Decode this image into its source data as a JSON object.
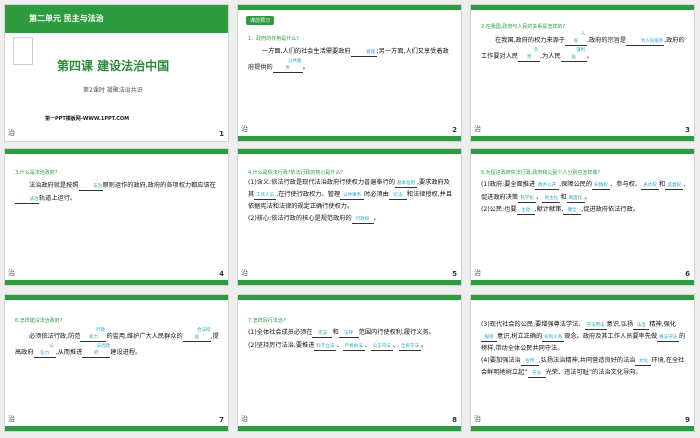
{
  "colors": {
    "green": "#2e9b3e",
    "blank": "#29a3c6"
  },
  "s1": {
    "unit": "第二单元 民主与法治",
    "lesson": "第四课 建设法治中国",
    "sub": "第2课时  凝聚法治共识",
    "footer": "第一PPT模板网-WWW.1PPT.COM",
    "num": "1"
  },
  "s2": {
    "tag": "课前预习",
    "q": "1．政府的作用是什么？",
    "t1": "一方面,人们的社会生活需要政府",
    "b1": "管理",
    "t2": ";另一方面,人们又享受着政府提供的",
    "b2": "公共服务",
    "t3": "。",
    "num": "2"
  },
  "s3": {
    "q": "2.在我国,政府与人民的关系是怎样的?",
    "t1": "在我国,政府的权力来源于",
    "b1": "人民",
    "t2": ",政府的宗旨是",
    "b2": "为人民服务",
    "t3": ",政府的工作要对人民",
    "b3": "负责",
    "t4": ",为人民",
    "b4": "谋利益",
    "t5": "。",
    "num": "3"
  },
  "s4": {
    "q": "3.什么是法治政府?",
    "t1": "法治政府就是按照",
    "b1": "法治",
    "t2": "原则运作的政府,政府的各项权力都应该在",
    "b2": "法治",
    "t3": "轨道上运行。",
    "num": "4"
  },
  "s5": {
    "q": "4.什么是依法行政?依法行政的核心是什么?",
    "t1": "(1)含义:依法行政是现代法治政府行使权力普遍奉行的",
    "b1": "基本准则",
    "t2": ",要求政府及其",
    "b2": "工作人员",
    "t3": ",在行使行政权力、管理",
    "b3": "公共事务",
    "t4": "时必须由",
    "b4": "宪法",
    "t5": "和法律授权,并且依据宪法和法律的规定正确行使权力。",
    "t6": "(2)核心:依法行政的核心是规范政府的",
    "b5": "行政权",
    "t7": "。",
    "num": "5"
  },
  "s6": {
    "q": "5.为促进政府依法行政,政府和公民个人分别应怎样做?",
    "t1": "(1)政府:要全面推进",
    "b1": "政务公开",
    "t2": ",保障公民的",
    "b2": "知情权",
    "t3": "、参与权、",
    "b3": "表达权",
    "t4": "和",
    "b4": "监督权",
    "t5": ",促进政府决策",
    "b5": "科学化",
    "t6": "、",
    "b6": "民主化",
    "t7": "和",
    "b7": "制度化",
    "t8": "。",
    "b8": "主动",
    "b9": "健全",
    "t9": "(2)公民:也要",
    "t10": ",献计献策,",
    "t11": ",促进政府依法行政。",
    "num": "6"
  },
  "s7": {
    "q": "6.怎样建设法治政府?",
    "t1": "必须依法行政,防范",
    "b1": "行政权力",
    "t2": "的滥用,维护广大人民群众的",
    "b2": "合法权益",
    "t3": ",提高政府",
    "b3": "公信力",
    "t4": ",从而推进",
    "b4": "法治政府",
    "t5": "建设进程。",
    "num": "7"
  },
  "s8": {
    "q": "7.怎样厉行法治?",
    "t1": "(1)全体社会成员必须在",
    "b1": "宪法",
    "t2": "和",
    "b2": "法律",
    "t3": "范围内行使权利,履行义务。",
    "t4": "(2)坚持厉行法治,要推进",
    "b3": "科学立法",
    "t5": "、",
    "b4": "严格执法",
    "t6": "、",
    "b5": "公正司法",
    "t7": "、",
    "b6": "全民守法",
    "t8": "。",
    "num": "8"
  },
  "s9": {
    "t1": "(3)现代社会的公民,要增强尊法学法、",
    "b1": "守法用法",
    "t2": "意识,弘扬",
    "b2": "法治",
    "t3": "精神,强化",
    "b3": "规则",
    "t4": "意识,树立正确的",
    "b4": "权利义务",
    "t5": "观念。政府及其工作人员要率先做",
    "b5": "尊法守法",
    "t6": "的榜样,带动全体公民共同守法。",
    "t7": "(4)要加强法治",
    "b6": "宣传",
    "t8": ",弘扬法治精神,共同营造良好的法治",
    "b7": "文化",
    "t9": "环境,在全社会鲜明地树立起“",
    "b8": "守法",
    "t10": "光荣、违法可耻”的法治文化导向。",
    "num": "9"
  },
  "icons": {
    "side": "治"
  }
}
